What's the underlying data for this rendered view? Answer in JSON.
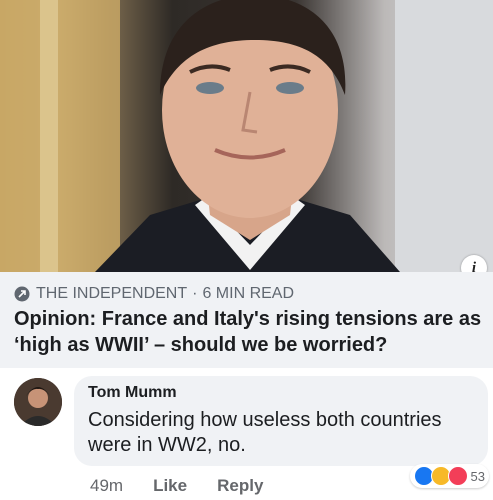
{
  "post": {
    "info_icon": "i",
    "source": "THE INDEPENDENT",
    "separator": "·",
    "read_time": "6 MIN READ",
    "headline": "Opinion: France and Italy's rising tensions are as ‘high as WWII’ – should we be worried?"
  },
  "comment": {
    "author": "Tom Mumm",
    "text": "Considering how useless both countries were in WW2, no.",
    "time": "49m",
    "like_label": "Like",
    "reply_label": "Reply",
    "reaction_count": "53",
    "reactions": [
      "like-icon",
      "haha-icon",
      "love-icon"
    ]
  },
  "colors": {
    "card_bg": "#f0f2f5",
    "meta_text": "#606770",
    "like_blue": "#1877f2",
    "haha_yellow": "#f7b928",
    "love_red": "#f33e58"
  }
}
